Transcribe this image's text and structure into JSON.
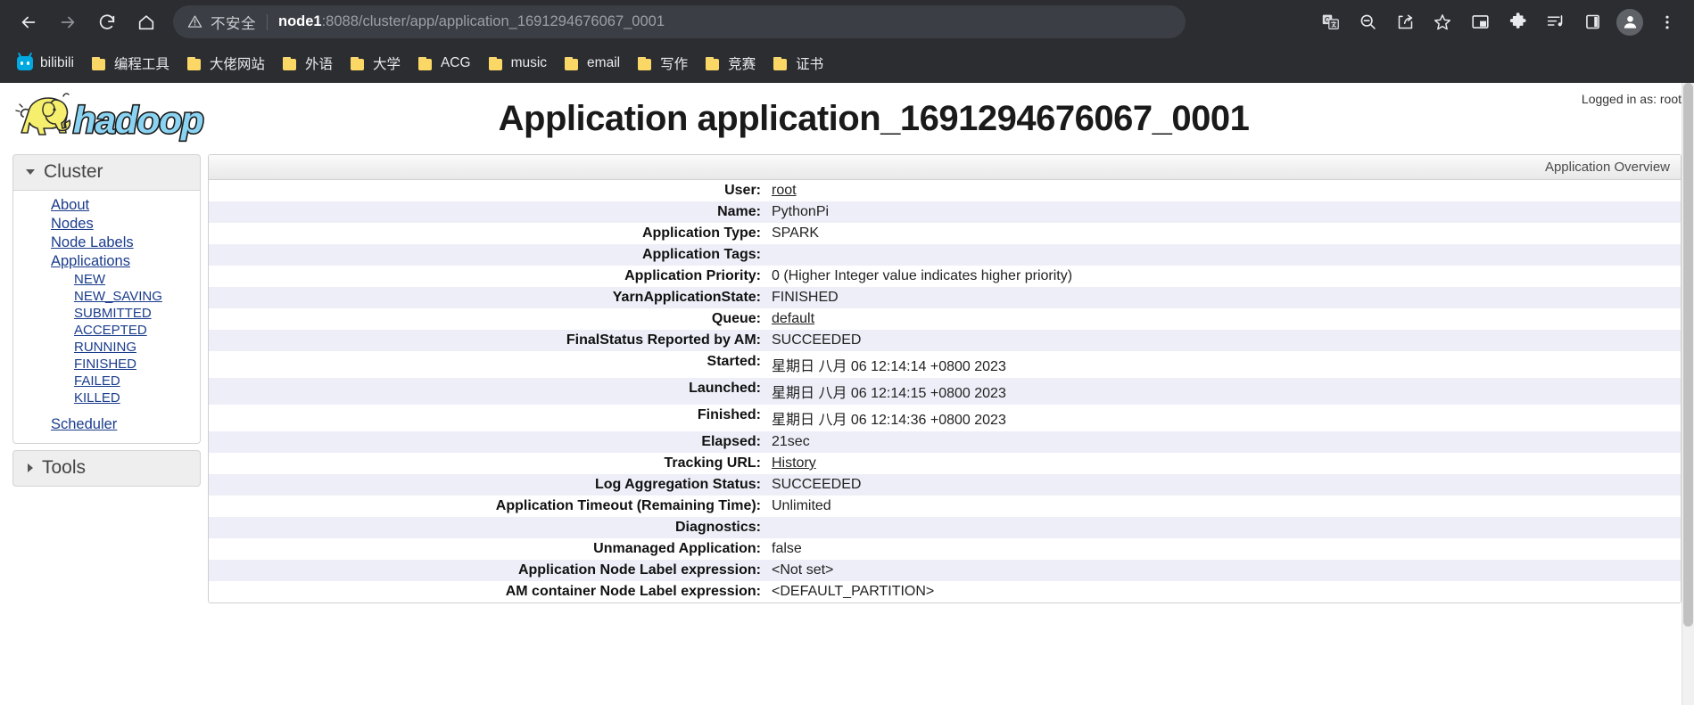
{
  "browser": {
    "nav_buttons": [
      {
        "name": "back",
        "glyph": "←"
      },
      {
        "name": "forward",
        "glyph": "→"
      },
      {
        "name": "reload",
        "glyph": "⟳"
      },
      {
        "name": "home",
        "glyph": "⌂"
      }
    ],
    "omnibox": {
      "security_label": "不安全",
      "url_host": "node1",
      "url_rest": ":8088/cluster/app/application_1691294676067_0001",
      "full_url": "node1:8088/cluster/app/application_1691294676067_0001"
    },
    "toolbar_icons": [
      "translate-icon",
      "zoom-out-icon",
      "share-icon",
      "bookmark-star-icon",
      "picture-in-picture-icon",
      "extensions-icon",
      "media-playlist-icon",
      "side-panel-icon",
      "profile-avatar-icon",
      "chrome-menu-icon"
    ],
    "bookmarks": [
      {
        "label": "bilibili",
        "icon": "bilibili-icon"
      },
      {
        "label": "编程工具",
        "icon": "folder-icon"
      },
      {
        "label": "大佬网站",
        "icon": "folder-icon"
      },
      {
        "label": "外语",
        "icon": "folder-icon"
      },
      {
        "label": "大学",
        "icon": "folder-icon"
      },
      {
        "label": "ACG",
        "icon": "folder-icon"
      },
      {
        "label": "music",
        "icon": "folder-icon"
      },
      {
        "label": "email",
        "icon": "folder-icon"
      },
      {
        "label": "写作",
        "icon": "folder-icon"
      },
      {
        "label": "竞赛",
        "icon": "folder-icon"
      },
      {
        "label": "证书",
        "icon": "folder-icon"
      }
    ]
  },
  "page": {
    "logo_alt": "hadoop",
    "title": "Application application_1691294676067_0001",
    "logged_in_as": "Logged in as: root"
  },
  "sidebar": {
    "cluster": {
      "title": "Cluster",
      "links": [
        {
          "label": "About",
          "level": 1
        },
        {
          "label": "Nodes",
          "level": 1
        },
        {
          "label": "Node Labels",
          "level": 1
        },
        {
          "label": "Applications",
          "level": 1
        },
        {
          "label": "NEW",
          "level": 2
        },
        {
          "label": "NEW_SAVING",
          "level": 2
        },
        {
          "label": "SUBMITTED",
          "level": 2
        },
        {
          "label": "ACCEPTED",
          "level": 2
        },
        {
          "label": "RUNNING",
          "level": 2
        },
        {
          "label": "FINISHED",
          "level": 2
        },
        {
          "label": "FAILED",
          "level": 2
        },
        {
          "label": "KILLED",
          "level": 2
        },
        {
          "label": "Scheduler",
          "level": 1,
          "spaced": true
        }
      ]
    },
    "tools": {
      "title": "Tools"
    }
  },
  "overview": {
    "caption": "Application Overview",
    "rows": [
      {
        "label": "User:",
        "value": "root",
        "link": true
      },
      {
        "label": "Name:",
        "value": "PythonPi",
        "link": false
      },
      {
        "label": "Application Type:",
        "value": "SPARK",
        "link": false
      },
      {
        "label": "Application Tags:",
        "value": "",
        "link": false
      },
      {
        "label": "Application Priority:",
        "value": "0 (Higher Integer value indicates higher priority)",
        "link": false
      },
      {
        "label": "YarnApplicationState:",
        "value": "FINISHED",
        "link": false
      },
      {
        "label": "Queue:",
        "value": "default",
        "link": true
      },
      {
        "label": "FinalStatus Reported by AM:",
        "value": "SUCCEEDED",
        "link": false
      },
      {
        "label": "Started:",
        "value": "星期日 八月 06 12:14:14 +0800 2023",
        "link": false
      },
      {
        "label": "Launched:",
        "value": "星期日 八月 06 12:14:15 +0800 2023",
        "link": false
      },
      {
        "label": "Finished:",
        "value": "星期日 八月 06 12:14:36 +0800 2023",
        "link": false
      },
      {
        "label": "Elapsed:",
        "value": "21sec",
        "link": false
      },
      {
        "label": "Tracking URL:",
        "value": "History",
        "link": true
      },
      {
        "label": "Log Aggregation Status:",
        "value": "SUCCEEDED",
        "link": false
      },
      {
        "label": "Application Timeout (Remaining Time):",
        "value": "Unlimited",
        "link": false
      },
      {
        "label": "Diagnostics:",
        "value": "",
        "link": false
      },
      {
        "label": "Unmanaged Application:",
        "value": "false",
        "link": false
      },
      {
        "label": "Application Node Label expression:",
        "value": "<Not set>",
        "link": false
      },
      {
        "label": "AM container Node Label expression:",
        "value": "<DEFAULT_PARTITION>",
        "link": false
      }
    ]
  }
}
